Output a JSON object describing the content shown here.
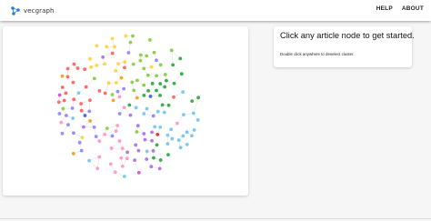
{
  "header": {
    "logo_text": "vecgraph",
    "nav": [
      {
        "label": "HELP"
      },
      {
        "label": "ABOUT"
      }
    ]
  },
  "graph": {
    "node_colors": [
      "#ff6a6a",
      "#ffd54a",
      "#8fd14f",
      "#3bb04a",
      "#7ec8f5",
      "#b07be8",
      "#ff9ecb",
      "#9a8cff",
      "#e53935",
      "#4f6fd8",
      "#f5a623",
      "#d85ad8"
    ],
    "edge_color": "#d3d3d3"
  },
  "info": {
    "title": "Click any article node to get started.",
    "hint": "Double click anywhere to deselect cluster."
  }
}
